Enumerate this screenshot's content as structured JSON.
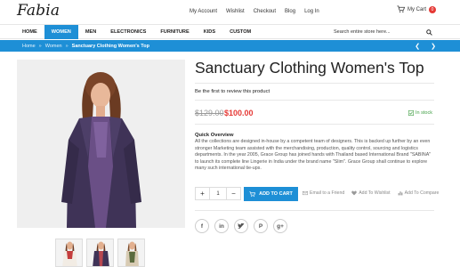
{
  "brand": {
    "logo_text": "Fabia"
  },
  "top_links": [
    "My Account",
    "Wishlist",
    "Checkout",
    "Blog",
    "Log In"
  ],
  "cart": {
    "label": "My Cart",
    "count": "0"
  },
  "nav": {
    "items": [
      "HOME",
      "WOMEN",
      "MEN",
      "ELECTRONICS",
      "FURNITURE",
      "KIDS",
      "CUSTOM"
    ],
    "active": "WOMEN"
  },
  "search": {
    "placeholder": "Search entire store here..."
  },
  "breadcrumb": {
    "items": [
      "Home",
      "Women"
    ],
    "current": "Sanctuary Clothing Women's Top",
    "separator": "»"
  },
  "product": {
    "title": "Sanctuary Clothing Women's Top",
    "review_prompt": "Be the first to review this product",
    "old_price": "$129.00",
    "new_price": "$100.00",
    "stock": "In stock",
    "overview_title": "Quick Overview",
    "overview_text": "All the collections are designed in-house by a competent team of designers. This is backed up further by an even stronger Marketing team assisted with the merchandising, production, quality control, sourcing and logistics departments. In the year 2005, Grace Group has joined hands with Thailand based International Brand \"SABINA\" to launch its complete line Lingerie in India under the brand name \"Slim\". Grace Group shall continue to explore many such international tie-ups.",
    "quantity": "1",
    "add_to_cart": "ADD TO CART",
    "actions": [
      "Email to a Friend",
      "Add To Wishlist",
      "Add To Compare"
    ]
  },
  "social_icons": [
    "facebook-icon",
    "linkedin-icon",
    "twitter-icon",
    "pinterest-icon",
    "google-plus-icon"
  ],
  "colors": {
    "accent": "#1e8fd6",
    "price": "#e53935",
    "stock": "#43a047"
  }
}
